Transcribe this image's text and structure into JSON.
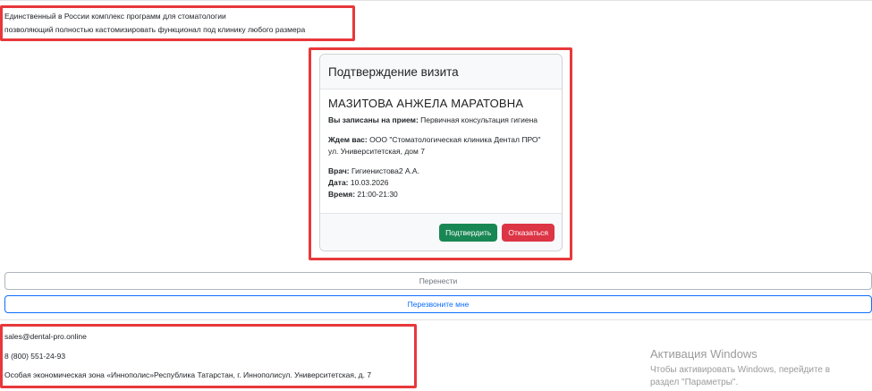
{
  "tagline": {
    "line1": "Единственный в России комплекс программ для стоматологии",
    "line2": "позволяющий полностью кастомизировать функционал под клинику любого размера"
  },
  "card": {
    "title": "Подтверждение визита",
    "patient_name": "МАЗИТОВА АНЖЕЛА МАРАТОВНА",
    "appointment_label": "Вы записаны на прием:",
    "appointment_value": "Первичная консультация гигиена",
    "waiting_label": "Ждем вас:",
    "waiting_value": "ООО \"Стоматологическая клиника Дентал ПРО\"",
    "address_value": "ул. Университетская, дом 7",
    "doctor_label": "Врач:",
    "doctor_value": "Гигиенистова2 А.А.",
    "date_label": "Дата:",
    "date_value": "10.03.2026",
    "time_label": "Время:",
    "time_value": "21:00-21:30",
    "confirm_label": "Подтвердить",
    "decline_label": "Отказаться"
  },
  "actions": {
    "reschedule_label": "Перенести",
    "callback_label": "Перезвоните мне"
  },
  "footer": {
    "email": "sales@dental-pro.online",
    "phone": "8 (800) 551-24-93",
    "address": "Особая экономическая зона «Иннополис»Республика Татарстан, г. Иннополисул. Университетская, д. 7"
  },
  "watermark": {
    "title": "Активация Windows",
    "line1": "Чтобы активировать Windows, перейдите в",
    "line2": "раздел \"Параметры\"."
  },
  "colors": {
    "highlight_frame": "#e8383b",
    "confirm": "#198754",
    "decline": "#dc3545",
    "callback": "#0d6efd",
    "reschedule": "#6c757d"
  }
}
